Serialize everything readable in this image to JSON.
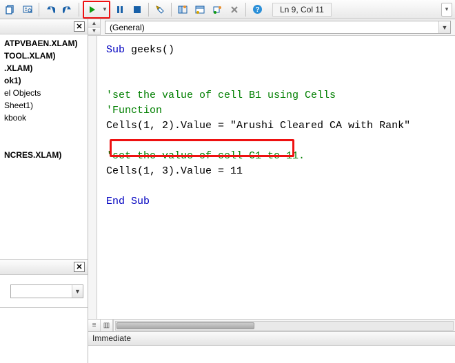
{
  "toolbar": {
    "status": "Ln 9, Col 11"
  },
  "project": {
    "items": [
      {
        "text": "ATPVBAEN.XLAM)",
        "bold": true
      },
      {
        "text": "TOOL.XLAM)",
        "bold": true
      },
      {
        "text": ".XLAM)",
        "bold": true
      },
      {
        "text": "ok1)",
        "bold": true
      },
      {
        "text": "el Objects",
        "bold": false
      },
      {
        "text": "Sheet1)",
        "bold": false
      },
      {
        "text": "kbook",
        "bold": false
      },
      {
        "text": "",
        "bold": false
      },
      {
        "text": "",
        "bold": false
      },
      {
        "text": "NCRES.XLAM)",
        "bold": true
      }
    ]
  },
  "object_dropdown": "(General)",
  "code": {
    "l1_kw": "Sub ",
    "l1_rest": "geeks()",
    "l3": "'set the value of cell B1 using Cells",
    "l4": "'Function",
    "l5": "Cells(1, 2).Value = \"Arushi Cleared CA with Rank\"",
    "l7": "'set the value of cell C1 to 11.",
    "l8": "Cells(1, 3).Value = 11",
    "l10": "End Sub"
  },
  "immediate": {
    "title": "Immediate"
  }
}
